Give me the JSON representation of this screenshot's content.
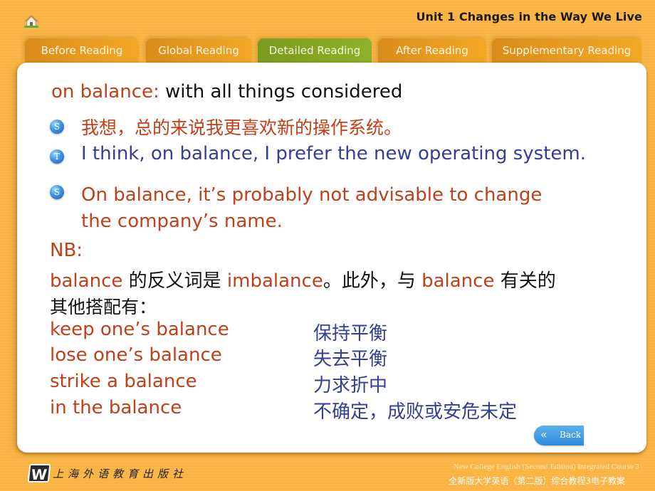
{
  "header": {
    "home_icon": "home-icon",
    "unit_title": "Unit 1 Changes in the Way We Live"
  },
  "tabs": [
    {
      "label": "Before Reading",
      "active": false
    },
    {
      "label": "Global Reading",
      "active": false
    },
    {
      "label": "Detailed Reading",
      "active": true
    },
    {
      "label": "After Reading",
      "active": false
    },
    {
      "label": "Supplementary Reading",
      "active": false
    }
  ],
  "content": {
    "term": "on balance:",
    "definition": " with all things considered",
    "examples": [
      {
        "badge": "S",
        "text": "我想，总的来说我更喜欢新的操作系统。"
      },
      {
        "badge": "T",
        "text": "I think, on balance, I prefer the new operating system."
      },
      {
        "badge": "S",
        "text_line1": "On balance, it’s probably not advisable to change",
        "text_line2": "the company’s name."
      }
    ],
    "nb_label": "NB:",
    "antonym_note": {
      "w1": "balance",
      "t1": " 的反义词是 ",
      "w2": "imbalance",
      "t2": "。此外，与 ",
      "w3": "balance",
      "t3": " 有关的",
      "line2": "其他搭配有："
    },
    "collocations": [
      {
        "en": "keep one’s balance",
        "zh": "保持平衡"
      },
      {
        "en": "lose one’s balance",
        "zh": "失去平衡"
      },
      {
        "en": "strike a balance",
        "zh": "力求折中"
      },
      {
        "en": "in the balance",
        "zh": "不确定，成败或安危未定"
      }
    ],
    "back_button": {
      "icon": "double-chevron-left-icon",
      "label": "Back"
    }
  },
  "footer": {
    "publisher_logo": "W",
    "publisher_name": "上海外语教育出版社",
    "course_en": "New College English (Second Edition) Integrated Course 3",
    "course_zh": "全新版大学英语（第二版）综合教程3电子教案"
  },
  "colors": {
    "accent_red": "#c0401a",
    "accent_navy": "#333f93",
    "tab_orange": "#e99a22",
    "tab_active_green": "#86a823",
    "background_orange": "#fbb748",
    "back_button_blue": "#2f8ad8"
  }
}
